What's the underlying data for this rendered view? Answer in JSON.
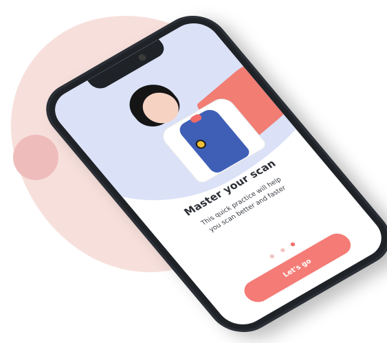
{
  "app": {
    "title": "Master your scan",
    "subtitle_line1": "This quick practice will help",
    "subtitle_line2": "you scan better and faster",
    "cta_label": "Let's go",
    "pager": {
      "count": 3,
      "active_index": 2
    }
  },
  "colors": {
    "background": "#ffffff",
    "blob": "#f7e0dc",
    "accent": "#f47b76",
    "hero_bg": "#dbe1f7",
    "phone_body": "#2b2f36"
  },
  "icons": {
    "camera": "camera-icon"
  }
}
